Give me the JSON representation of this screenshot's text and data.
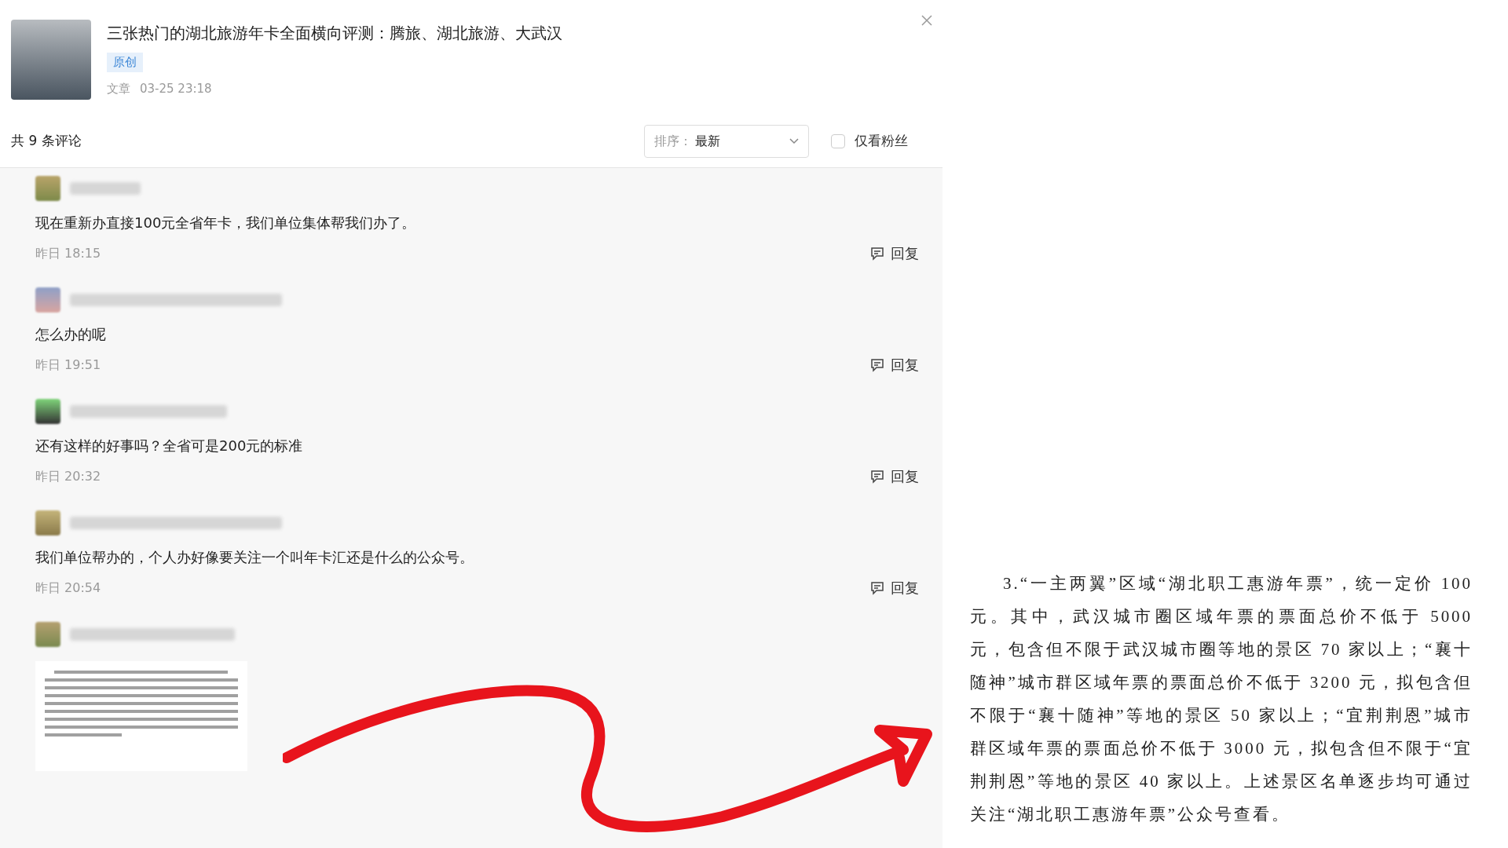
{
  "article": {
    "title": "三张热门的湖北旅游年卡全面横向评测：腾旅、湖北旅游、大武汉",
    "badge": "原创",
    "type": "文章",
    "time": "03-25 23:18"
  },
  "comments_header": {
    "count": "共 9 条评论",
    "sort": {
      "label": "排序：",
      "value": "最新"
    },
    "fans_only": {
      "label": "仅看粉丝",
      "checked": false
    }
  },
  "comments": [
    {
      "kind": "text",
      "text": "现在重新办直接100元全省年卡，我们单位集体帮我们办了。",
      "time": "昨日 18:15",
      "reply": "回复"
    },
    {
      "kind": "text",
      "text": "怎么办的呢",
      "time": "昨日 19:51",
      "reply": "回复"
    },
    {
      "kind": "text",
      "text": "还有这样的好事吗？全省可是200元的标准",
      "time": "昨日 20:32",
      "reply": "回复"
    },
    {
      "kind": "text",
      "text": "我们单位帮办的，个人办好像要关注一个叫年卡汇还是什么的公众号。",
      "time": "昨日 20:54",
      "reply": "回复"
    },
    {
      "kind": "image"
    }
  ],
  "document": {
    "paragraph": "3.“一主两翼”区域“湖北职工惠游年票”，统一定价 100 元。其中，武汉城市圈区域年票的票面总价不低于 5000 元，包含但不限于武汉城市圈等地的景区 70 家以上；“襄十随神”城市群区域年票的票面总价不低于 3200 元，拟包含但不限于“襄十随神”等地的景区 50 家以上；“宜荆荆恩”城市群区域年票的票面总价不低于 3000 元，拟包含但不限于“宜荆荆恩”等地的景区 40 家以上。上述景区名单逐步均可通过关注“湖北职工惠游年票”公众号查看。"
  }
}
